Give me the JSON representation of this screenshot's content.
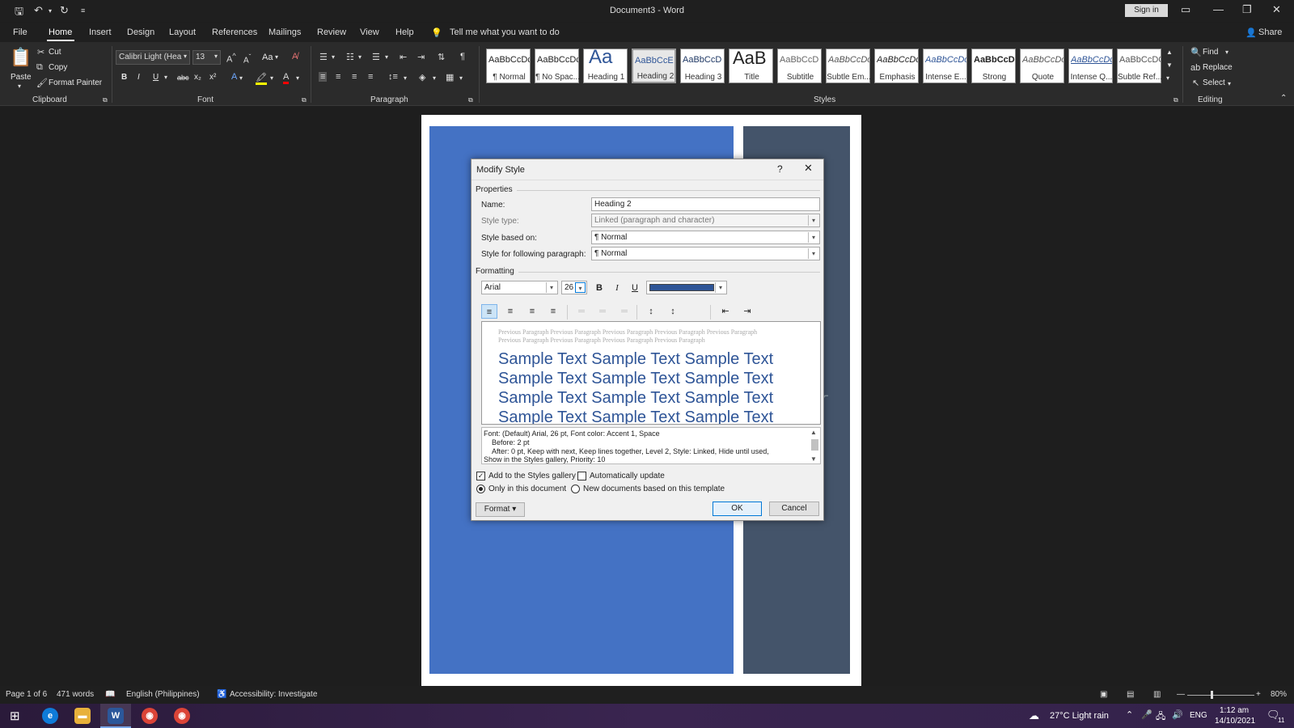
{
  "titlebar": {
    "doc_title": "Document3  -  Word",
    "sign_in": "Sign in"
  },
  "tabs": [
    {
      "label": "File"
    },
    {
      "label": "Home"
    },
    {
      "label": "Insert"
    },
    {
      "label": "Design"
    },
    {
      "label": "Layout"
    },
    {
      "label": "References"
    },
    {
      "label": "Mailings"
    },
    {
      "label": "Review"
    },
    {
      "label": "View"
    },
    {
      "label": "Help"
    }
  ],
  "tell_me": "Tell me what you want to do",
  "share": "Share",
  "clipboard": {
    "paste": "Paste",
    "cut": "Cut",
    "copy": "Copy",
    "format_painter": "Format Painter",
    "label": "Clipboard"
  },
  "font": {
    "name": "Calibri Light (Hea",
    "size": "13",
    "label": "Font",
    "bold": "B",
    "italic": "I",
    "underline": "U",
    "strike": "abc",
    "sub": "x₂",
    "sup": "x²",
    "change_case": "Aa"
  },
  "paragraph": {
    "label": "Paragraph"
  },
  "styles": {
    "label": "Styles",
    "items": [
      {
        "preview": "AaBbCcDc",
        "name": "¶ Normal"
      },
      {
        "preview": "AaBbCcDc",
        "name": "¶ No Spac..."
      },
      {
        "preview": "Aa",
        "name": "Heading 1"
      },
      {
        "preview": "AaBbCcE",
        "name": "Heading 2"
      },
      {
        "preview": "AaBbCcD",
        "name": "Heading 3"
      },
      {
        "preview": "AaB",
        "name": "Title"
      },
      {
        "preview": "AaBbCcD",
        "name": "Subtitle"
      },
      {
        "preview": "AaBbCcDc",
        "name": "Subtle Em..."
      },
      {
        "preview": "AaBbCcDc",
        "name": "Emphasis"
      },
      {
        "preview": "AaBbCcDc",
        "name": "Intense E..."
      },
      {
        "preview": "AaBbCcDc",
        "name": "Strong"
      },
      {
        "preview": "AaBbCcDc",
        "name": "Quote"
      },
      {
        "preview": "AaBbCcDc",
        "name": "Intense Q..."
      },
      {
        "preview": "AaBbCcDC",
        "name": "Subtle Ref..."
      }
    ]
  },
  "editing": {
    "label": "Editing",
    "find": "Find",
    "replace": "Replace",
    "select": "Select"
  },
  "dialog": {
    "title": "Modify Style",
    "help": "?",
    "properties": "Properties",
    "name_label": "Name:",
    "name_value": "Heading 2",
    "style_type_label": "Style type:",
    "style_type_value": "Linked (paragraph and character)",
    "based_on_label": "Style based on:",
    "based_on_value": "¶  Normal",
    "following_label": "Style for following paragraph:",
    "following_value": "¶  Normal",
    "formatting": "Formatting",
    "font_value": "Arial",
    "size_value": "26",
    "font_color": "#2f5597",
    "prev_paragraph": "Previous Paragraph Previous Paragraph Previous Paragraph Previous Paragraph Previous Paragraph Previous Paragraph Previous Paragraph Previous Paragraph Previous Paragraph",
    "sample_lines": [
      "Sample Text Sample Text Sample Text",
      "Sample Text Sample Text Sample Text",
      "Sample Text Sample Text Sample Text",
      "Sample Text Sample Text Sample Text"
    ],
    "desc_lines": [
      "Font: (Default) Arial, 26 pt, Font color: Accent 1, Space",
      "Before:  2 pt",
      "After:  0 pt, Keep with next, Keep lines together, Level 2, Style: Linked, Hide until used,",
      "Show in the Styles gallery, Priority: 10"
    ],
    "add_gallery": "Add to the Styles gallery",
    "auto_update": "Automatically update",
    "only_doc": "Only in this document",
    "new_docs": "New documents based on this template",
    "format_btn": "Format ▾",
    "ok": "OK",
    "cancel": "Cancel"
  },
  "status": {
    "page": "Page 1 of 6",
    "words": "471 words",
    "language": "English (Philippines)",
    "accessibility": "Accessibility: Investigate",
    "zoom": "80%"
  },
  "taskbar": {
    "weather": "27°C  Light rain",
    "lang": "ENG",
    "time": "1:12 am",
    "date": "14/10/2021",
    "notif": "11"
  }
}
